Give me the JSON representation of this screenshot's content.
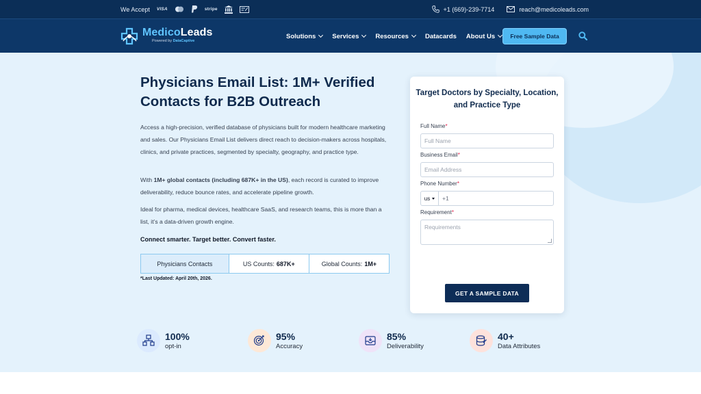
{
  "topbar": {
    "we_accept": "We Accept",
    "visa": "VISA",
    "stripe": "stripe",
    "phone": "+1 (669)-239-7714",
    "email": "reach@medicoleads.com"
  },
  "brand": {
    "name_a": "Medico",
    "name_b": "Leads",
    "powered_by": "Powered by",
    "powered_brand": "DataCaptive"
  },
  "nav": {
    "items": [
      {
        "label": "Solutions",
        "dropdown": true
      },
      {
        "label": "Services",
        "dropdown": true
      },
      {
        "label": "Resources",
        "dropdown": true
      },
      {
        "label": "Datacards",
        "dropdown": false
      },
      {
        "label": "About Us",
        "dropdown": true
      }
    ],
    "cta_label": "Free Sample Data"
  },
  "hero": {
    "title": "Physicians Email List: 1M+ Verified Contacts for B2B Outreach",
    "p1": "Access a high-precision, verified database of physicians built for modern healthcare marketing and sales. Our Physicians Email List delivers direct reach to decision-makers across hospitals, clinics, and private practices, segmented by specialty, geography, and practice type.",
    "p2_prefix": "With ",
    "p2_bold": "1M+ global contacts (including 687K+ in the US)",
    "p2_suffix": ", each record is curated to improve deliverability, reduce bounce rates, and accelerate pipeline growth.",
    "p3": "Ideal for pharma, medical devices, healthcare SaaS, and research teams, this is more than a list, it’s a data-driven growth engine.",
    "p4": "Connect smarter. Target better. Convert faster.",
    "counts": {
      "label": "Physicians Contacts",
      "us_label": "US Counts:",
      "us_value": "687K+",
      "global_label": "Global Counts:",
      "global_value": "1M+"
    },
    "last_updated": "*Last Updated: April 20th, 2026."
  },
  "form": {
    "title": "Target Doctors by Specialty, Location, and Practice Type",
    "full_name_label": "Full Name",
    "full_name_placeholder": "Full Name",
    "email_label": "Business Email",
    "email_placeholder": "Email Address",
    "phone_label": "Phone Number",
    "country_code": "us",
    "phone_prefix": "+1",
    "req_label": "Requirement",
    "req_placeholder": "Requirements",
    "required_mark": "*",
    "submit": "GET A SAMPLE DATA"
  },
  "stats": [
    {
      "value": "100%",
      "label": "opt-in",
      "icon": "network-icon",
      "bg": "#dbeafe"
    },
    {
      "value": "95%",
      "label": "Accuracy",
      "icon": "target-icon",
      "bg": "#fde8d7"
    },
    {
      "value": "85%",
      "label": "Deliverability",
      "icon": "inbox-icon",
      "bg": "#efe3f8"
    },
    {
      "value": "40+",
      "label": "Data Attributes",
      "icon": "database-icon",
      "bg": "#fde2dc"
    }
  ],
  "colors": {
    "topbar": "#0b2e57",
    "navbar": "#0d3768",
    "accent": "#4fb8f2",
    "hero_bg": "#e4f2fc",
    "button_dark": "#0d2d57"
  }
}
